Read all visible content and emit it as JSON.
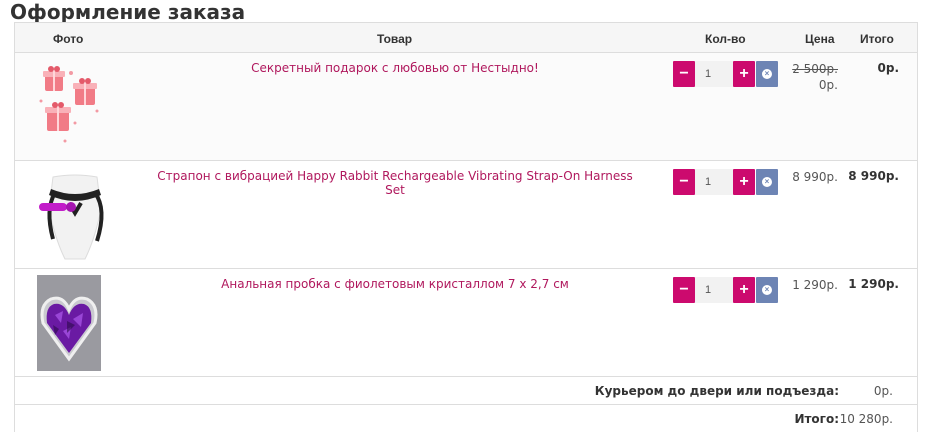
{
  "page": {
    "title": "Оформление заказа"
  },
  "table": {
    "headers": {
      "photo": "Фото",
      "product": "Товар",
      "qty": "Кол-во",
      "price": "Цена",
      "total": "Итого"
    },
    "items": [
      {
        "name": "Секретный подарок с любовью от Нестыдно!",
        "qty": "1",
        "old_price": "2 500р.",
        "price": "0р.",
        "total": "0р.",
        "image": "pink-gift-boxes"
      },
      {
        "name": "Страпон с вибрацией Happy Rabbit Rechargeable Vibrating Strap-On Harness Set",
        "qty": "1",
        "price": "8 990р.",
        "total": "8 990р.",
        "image": "strap-on-harness"
      },
      {
        "name": "Анальная пробка с фиолетовым кристаллом 7 х 2,7 см",
        "qty": "1",
        "price": "1 290р.",
        "total": "1 290р.",
        "image": "purple-heart-crystal"
      }
    ],
    "buttons": {
      "minus": "−",
      "plus": "+",
      "remove": "×"
    }
  },
  "summary": {
    "delivery_label": "Курьером до двери или подъезда:",
    "delivery_value": "0р.",
    "total_label": "Итого:",
    "total_value": "10 280р."
  },
  "colors": {
    "accent": "#cc0a6e",
    "link": "#b0185d",
    "remove_button": "#6d84b4"
  }
}
